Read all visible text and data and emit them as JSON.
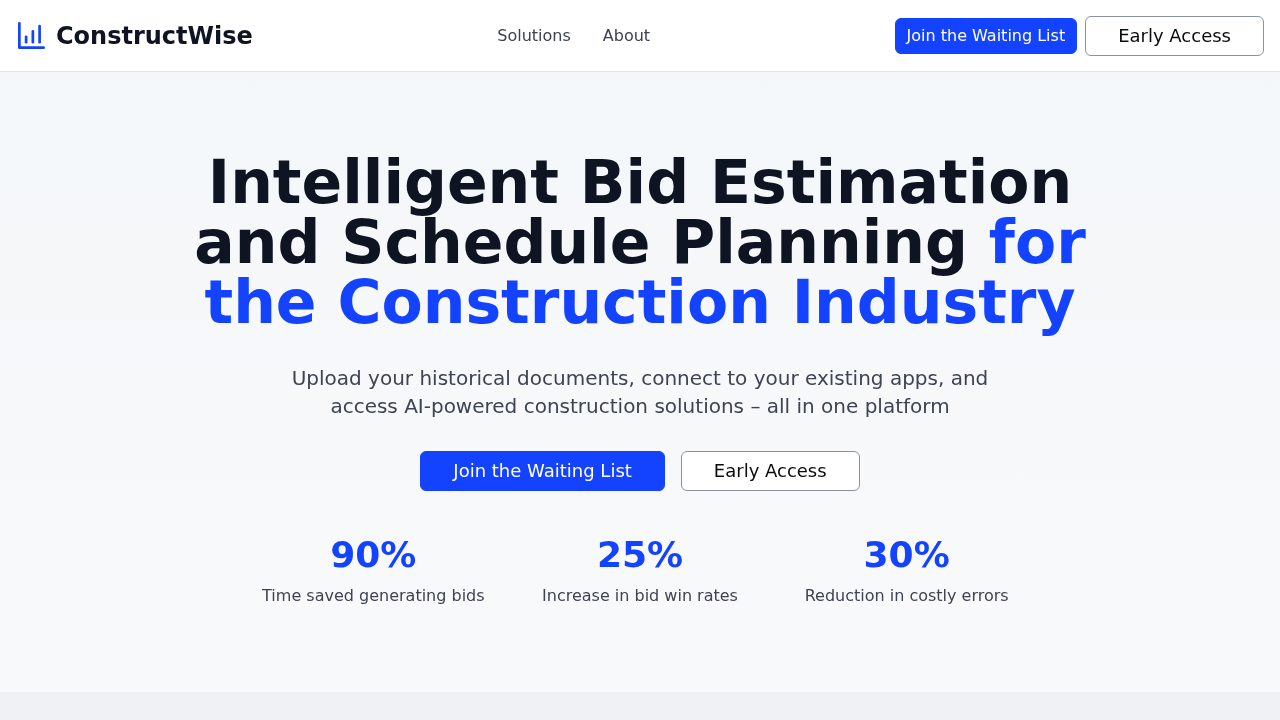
{
  "header": {
    "logo": "ConstructWise",
    "nav": [
      "Solutions",
      "About"
    ],
    "buttons": [
      {
        "label": "Join the Waiting List",
        "kind": "primary"
      },
      {
        "label": "Early Access",
        "kind": "outline"
      }
    ]
  },
  "hero": {
    "headline": "Intelligent Bid Estimation and Schedule Planning",
    "headline_highlight": "for the Construction Industry",
    "subtitle": "Upload your historical documents, connect to your existing apps, and access AI-powered construction solutions – all in one platform",
    "buttons": [
      {
        "label": "Join the Waiting List",
        "kind": "primary"
      },
      {
        "label": "Early Access",
        "kind": "outline"
      }
    ],
    "stats": [
      {
        "value": "90%",
        "label": "Time saved generating bids"
      },
      {
        "value": "25%",
        "label": "Increase in bid win rates"
      },
      {
        "value": "30%",
        "label": "Reduction in costly errors"
      }
    ]
  }
}
